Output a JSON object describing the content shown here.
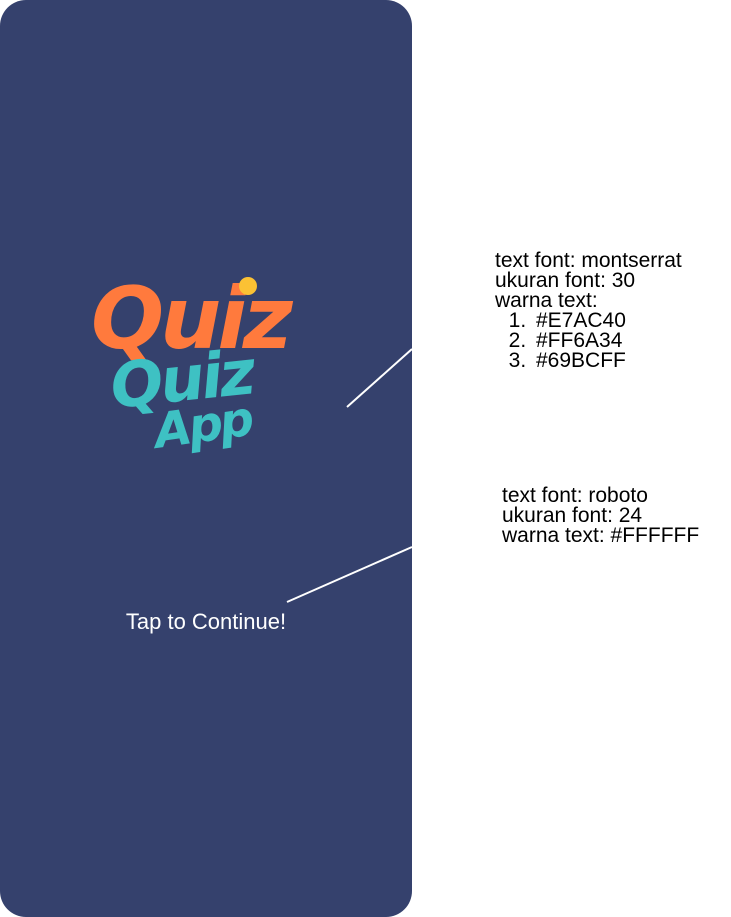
{
  "screen": {
    "background": "#35416D",
    "tap_label": "Tap to Continue!",
    "tap_color": "#FFFFFF"
  },
  "logo": {
    "words": [
      "Quiz",
      "Quiz",
      "App"
    ],
    "colors": {
      "quiz_main": "#FF7A3D",
      "quiz_accent": "#FBC134",
      "quiz_secondary": "#3EC1C3"
    }
  },
  "notes": {
    "logo_spec": {
      "font_line": "text font: montserrat",
      "size_line": "ukuran font: 30",
      "color_heading": "warna text:",
      "colors": [
        "#E7AC40",
        "#FF6A34",
        "#69BCFF"
      ]
    },
    "text_spec": {
      "font_line": "text font: roboto",
      "size_line": "ukuran font: 24",
      "color_line": "warna text: #FFFFFF"
    }
  }
}
